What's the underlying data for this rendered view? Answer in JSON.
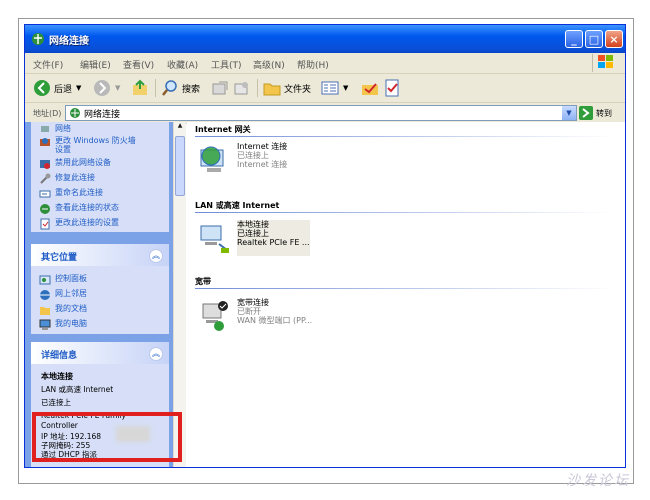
{
  "window": {
    "title": "网络连接"
  },
  "menu": [
    "文件(F)",
    "编辑(E)",
    "查看(V)",
    "收藏(A)",
    "工具(T)",
    "高级(N)",
    "帮助(H)"
  ],
  "toolbar": {
    "back": "后退",
    "search": "搜索",
    "folders": "文件夹"
  },
  "address": {
    "label": "地址(D)",
    "value": "网络连接",
    "go": "转到"
  },
  "tasks": {
    "items": [
      {
        "label": "网络",
        "icon": "network-icon"
      },
      {
        "label": "更改 Windows 防火墙设置",
        "icon": "firewall-icon"
      },
      {
        "label": "禁用此网络设备",
        "icon": "disable-icon"
      },
      {
        "label": "修复此连接",
        "icon": "repair-icon"
      },
      {
        "label": "重命名此连接",
        "icon": "rename-icon"
      },
      {
        "label": "查看此连接的状态",
        "icon": "status-icon"
      },
      {
        "label": "更改此连接的设置",
        "icon": "settings-icon"
      }
    ]
  },
  "other_places": {
    "title": "其它位置",
    "items": [
      {
        "label": "控制面板",
        "icon": "control-panel-icon"
      },
      {
        "label": "网上邻居",
        "icon": "network-places-icon"
      },
      {
        "label": "我的文档",
        "icon": "my-documents-icon"
      },
      {
        "label": "我的电脑",
        "icon": "my-computer-icon"
      }
    ]
  },
  "details": {
    "title": "详细信息",
    "name": "本地连接",
    "lines": [
      "LAN 或高速 Internet",
      "已连接上",
      "Realtek PCIe FE Family",
      "Controller",
      "IP 地址: 192.168",
      "子网掩码: 255",
      "通过 DHCP 指派"
    ]
  },
  "sections": [
    {
      "heading": "Internet 网关",
      "items": [
        {
          "name": "Internet 连接",
          "status": "已连接上",
          "device": "Internet 连接"
        }
      ]
    },
    {
      "heading": "LAN 或高速 Internet",
      "items": [
        {
          "name": "本地连接",
          "status": "已连接上",
          "device": "Realtek PCIe FE ..."
        }
      ]
    },
    {
      "heading": "宽带",
      "items": [
        {
          "name": "宽带连接",
          "status": "已断开",
          "device": "WAN 微型端口 (PP..."
        }
      ]
    }
  ],
  "watermark": "沙发论坛",
  "colors": {
    "title_bar": "#0058ee",
    "task_pane": "#7ba2e7",
    "highlight_box": "#e0201f"
  }
}
